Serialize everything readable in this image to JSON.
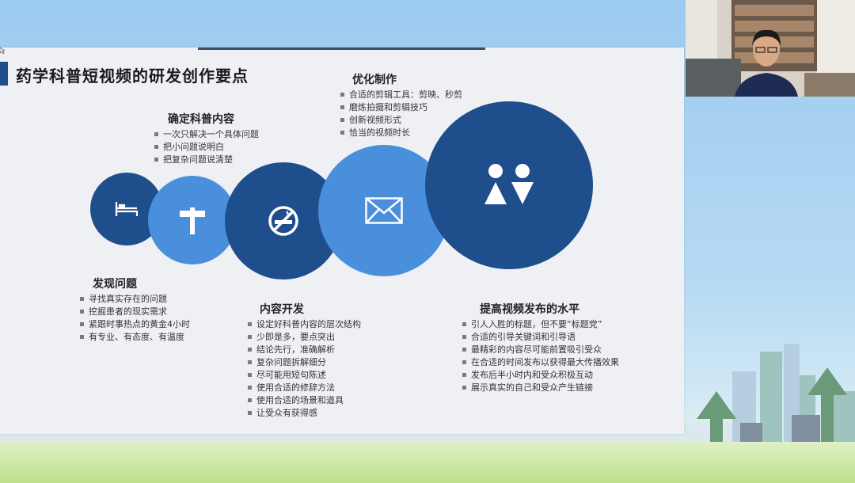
{
  "slide": {
    "title": "药学科普短视频的研发创作要点",
    "sections": [
      {
        "heading": "确定科普内容",
        "items": [
          "一次只解决一个具体问题",
          "把小问题说明白",
          "把复杂问题说清楚"
        ]
      },
      {
        "heading": "优化制作",
        "items": [
          "合适的剪辑工具：剪映、秒剪",
          "磨炼拍摄和剪辑技巧",
          "创新视频形式",
          "恰当的视频时长"
        ]
      },
      {
        "heading": "发现问题",
        "items": [
          "寻找真实存在的问题",
          "挖掘患者的现实需求",
          "紧跟时事热点的黄金4小时",
          "有专业、有态度、有温度"
        ]
      },
      {
        "heading": "内容开发",
        "items": [
          "设定好科普内容的层次结构",
          "少即是多，要点突出",
          "结论先行，准确解析",
          "复杂问题拆解细分",
          "尽可能用短句陈述",
          "使用合适的修辞方法",
          "使用合适的场景和道具",
          "让受众有获得感"
        ]
      },
      {
        "heading": "提高视频发布的水平",
        "items": [
          "引人入胜的标题，但不要“标题党”",
          "合适的引导关键词和引导语",
          "最精彩的内容尽可能前置吸引受众",
          "在合适的时间发布以获得最大传播效果",
          "发布后半小时内和受众积极互动",
          "展示真实的自己和受众产生链接"
        ]
      }
    ],
    "circles": [
      {
        "icon": "bed-icon",
        "color": "#1f4e8c"
      },
      {
        "icon": "signpost-icon",
        "color": "#4a8fdc"
      },
      {
        "icon": "no-smoking-icon",
        "color": "#1f4e8c"
      },
      {
        "icon": "envelope-icon",
        "color": "#4a8fdc"
      },
      {
        "icon": "people-icon",
        "color": "#1f4e8c"
      }
    ]
  },
  "colors": {
    "dark_blue": "#1f4e8c",
    "light_blue": "#4a8fdc"
  }
}
